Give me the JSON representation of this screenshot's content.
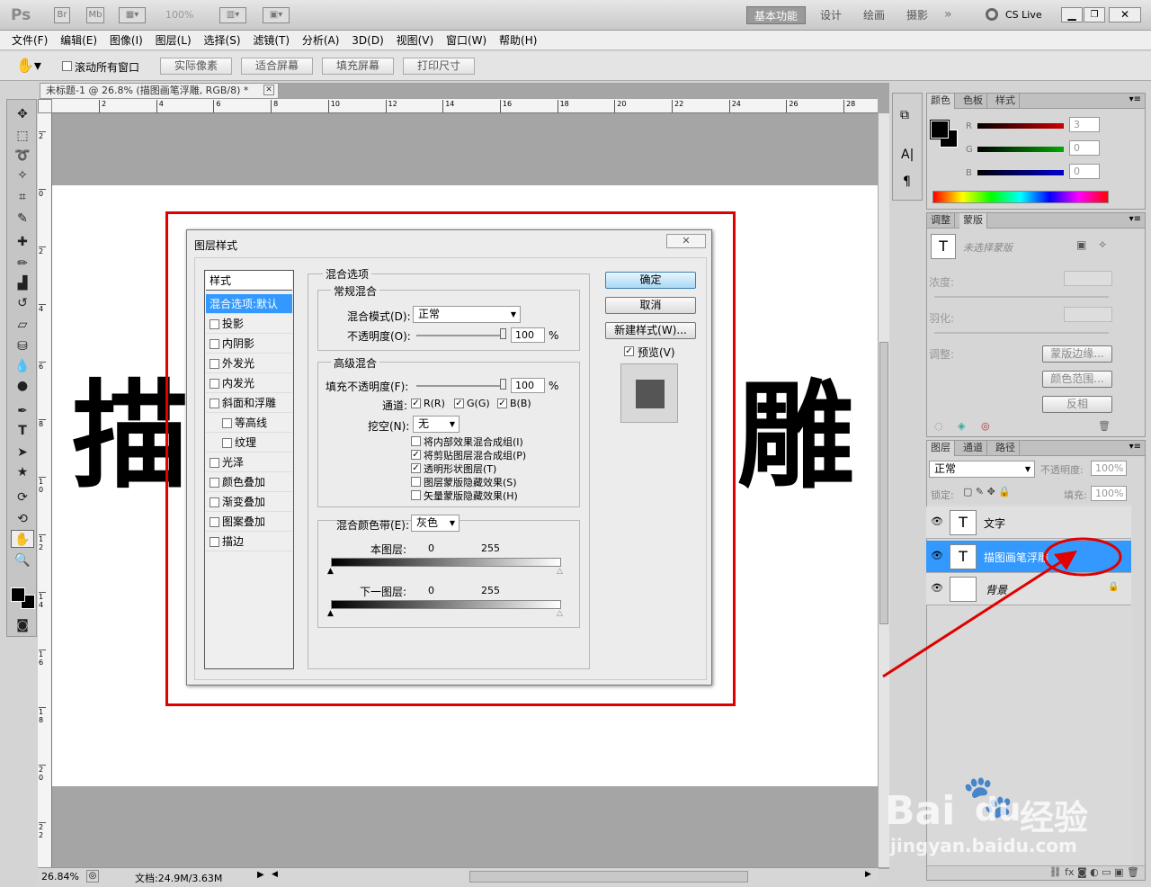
{
  "app": {
    "logo": "Ps",
    "zoom": "100%",
    "workspaces": [
      "基本功能",
      "设计",
      "绘画",
      "摄影"
    ],
    "cslive": "CS Live"
  },
  "menu": [
    "文件(F)",
    "编辑(E)",
    "图像(I)",
    "图层(L)",
    "选择(S)",
    "滤镜(T)",
    "分析(A)",
    "3D(D)",
    "视图(V)",
    "窗口(W)",
    "帮助(H)"
  ],
  "options": {
    "scroll_all": "滚动所有窗口",
    "buttons": [
      "实际像素",
      "适合屏幕",
      "填充屏幕",
      "打印尺寸"
    ]
  },
  "document": {
    "tab_title": "未标题-1 @ 26.8% (描图画笔浮雕, RGB/8) *",
    "canvas_text_left": "描",
    "canvas_text_right": "雕",
    "zoom_status": "26.84%",
    "doc_size": "文档:24.9M/3.63M",
    "ruler_top": [
      "2",
      "4",
      "6",
      "8",
      "10",
      "12",
      "14",
      "16",
      "18",
      "20",
      "22",
      "24",
      "26",
      "28"
    ],
    "ruler_left": [
      "2",
      "0",
      "2",
      "4",
      "6",
      "8",
      "1 0",
      "1 2",
      "1 4",
      "1 6",
      "1 8",
      "2 0",
      "2 2"
    ]
  },
  "dialog": {
    "title": "图层样式",
    "styles_header": "样式",
    "styles": [
      "混合选项:默认",
      "投影",
      "内阴影",
      "外发光",
      "内发光",
      "斜面和浮雕",
      "等高线",
      "纹理",
      "光泽",
      "颜色叠加",
      "渐变叠加",
      "图案叠加",
      "描边"
    ],
    "blend_options": "混合选项",
    "general_blend": "常规混合",
    "blend_mode_label": "混合模式(D):",
    "blend_mode_value": "正常",
    "opacity_label": "不透明度(O):",
    "opacity_value": "100",
    "percent": "%",
    "advanced_blend": "高级混合",
    "fill_opacity_label": "填充不透明度(F):",
    "fill_opacity_value": "100",
    "channels_label": "通道:",
    "channels": [
      "R(R)",
      "G(G)",
      "B(B)"
    ],
    "knockout_label": "挖空(N):",
    "knockout_value": "无",
    "checks": [
      {
        "label": "将内部效果混合成组(I)",
        "checked": false
      },
      {
        "label": "将剪贴图层混合成组(P)",
        "checked": true
      },
      {
        "label": "透明形状图层(T)",
        "checked": true
      },
      {
        "label": "图层蒙版隐藏效果(S)",
        "checked": false
      },
      {
        "label": "矢量蒙版隐藏效果(H)",
        "checked": false
      }
    ],
    "blend_if_label": "混合颜色带(E):",
    "blend_if_value": "灰色",
    "this_layer": "本图层:",
    "underlying_layer": "下一图层:",
    "range_min": "0",
    "range_max": "255",
    "ok": "确定",
    "cancel": "取消",
    "new_style": "新建样式(W)...",
    "preview": "预览(V)"
  },
  "color_panel": {
    "tabs": [
      "颜色",
      "色板",
      "样式"
    ],
    "channels": [
      {
        "name": "R",
        "value": "3",
        "color": "#cc0000"
      },
      {
        "name": "G",
        "value": "0",
        "color": "#00aa00"
      },
      {
        "name": "B",
        "value": "0",
        "color": "#0000cc"
      }
    ]
  },
  "masks_panel": {
    "tabs": [
      "调整",
      "蒙版"
    ],
    "no_mask": "未选择蒙版",
    "density": "浓度:",
    "feather": "羽化:",
    "adjust": "调整:",
    "buttons": [
      "蒙版边缘...",
      "颜色范围...",
      "反相"
    ]
  },
  "layers_panel": {
    "tabs": [
      "图层",
      "通道",
      "路径"
    ],
    "blend_mode": "正常",
    "opacity_label": "不透明度:",
    "opacity_value": "100%",
    "lock_label": "锁定:",
    "fill_label": "填充:",
    "fill_value": "100%",
    "layers": [
      {
        "name": "文字",
        "thumb": "T",
        "selected": false
      },
      {
        "name": "描图画笔浮雕",
        "thumb": "T",
        "selected": true
      },
      {
        "name": "背景",
        "thumb": "",
        "selected": false
      }
    ]
  },
  "watermark": {
    "brand": "Bai",
    "brand2": "du",
    "cn": "经验",
    "url": "jingyan.baidu.com"
  }
}
